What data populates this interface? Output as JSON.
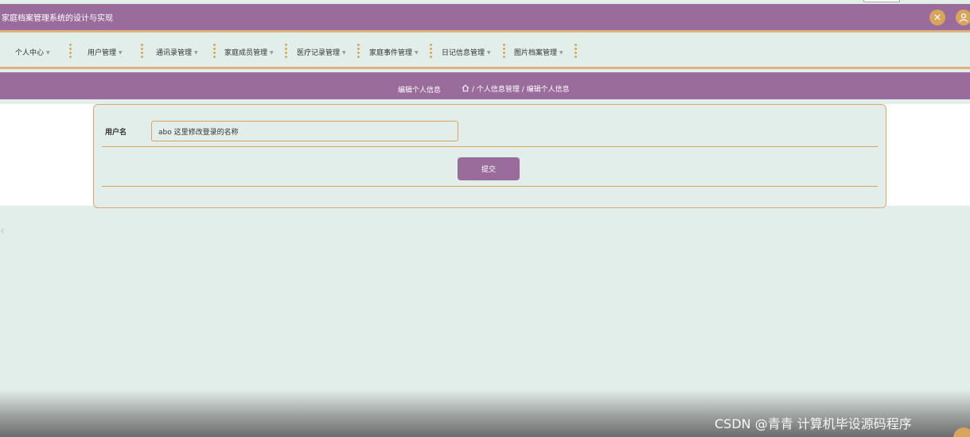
{
  "header": {
    "app_title": "家庭档案管理系统的设计与实现",
    "fullscreen_icon": "expand-icon",
    "user_icon": "user-icon"
  },
  "nav": {
    "items": [
      {
        "label": "个人中心"
      },
      {
        "label": "用户管理"
      },
      {
        "label": "通讯录管理"
      },
      {
        "label": "家庭成员管理"
      },
      {
        "label": "医疗记录管理"
      },
      {
        "label": "家庭事件管理"
      },
      {
        "label": "日记信息管理"
      },
      {
        "label": "图片档案管理"
      }
    ]
  },
  "breadcrumb": {
    "page_title": "编辑个人信息",
    "path": "/ 个人信息管理 / 编辑个人信息"
  },
  "form": {
    "username_label": "用户名",
    "username_value": "abo 这里修改登录的名称",
    "submit_label": "提交"
  },
  "watermark": "CSDN @青青  计算机毕设源码程序",
  "colors": {
    "primary": "#9a6c9c",
    "accent": "#d9a45c",
    "background": "#e2eeea"
  }
}
